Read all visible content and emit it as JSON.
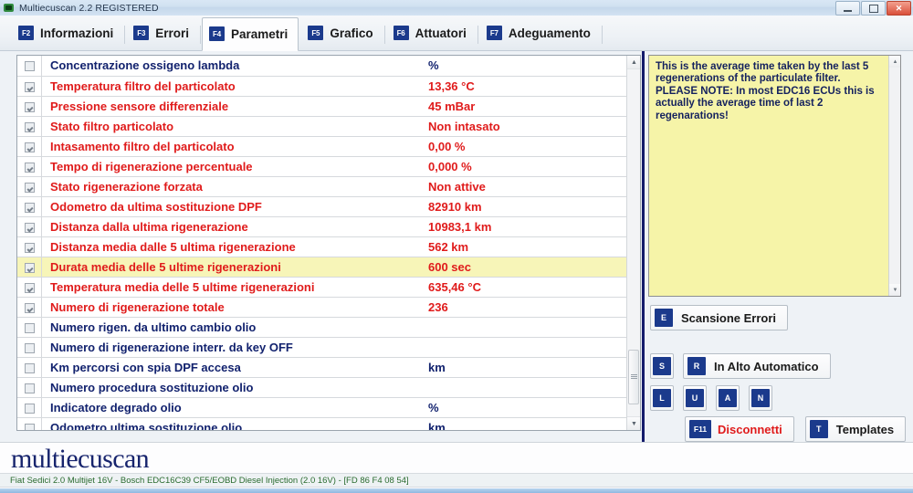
{
  "window": {
    "title": "Multiecuscan 2.2 REGISTERED",
    "icon": "app-icon",
    "minimize": "minimize-icon",
    "maximize": "maximize-icon",
    "close": "✕"
  },
  "tabs": [
    {
      "key": "F2",
      "label": "Informazioni",
      "active": false
    },
    {
      "key": "F3",
      "label": "Errori",
      "active": false
    },
    {
      "key": "F4",
      "label": "Parametri",
      "active": true
    },
    {
      "key": "F5",
      "label": "Grafico",
      "active": false
    },
    {
      "key": "F6",
      "label": "Attuatori",
      "active": false
    },
    {
      "key": "F7",
      "label": "Adeguamento",
      "active": false
    }
  ],
  "table": {
    "rows": [
      {
        "checked": false,
        "name": "Concentrazione ossigeno lambda",
        "value": "%",
        "color": "navy",
        "highlight": false
      },
      {
        "checked": true,
        "name": "Temperatura filtro del particolato",
        "value": "13,36 °C",
        "color": "red",
        "highlight": false
      },
      {
        "checked": true,
        "name": "Pressione sensore differenziale",
        "value": "45 mBar",
        "color": "red",
        "highlight": false
      },
      {
        "checked": true,
        "name": "Stato filtro particolato",
        "value": "Non intasato",
        "color": "red",
        "highlight": false
      },
      {
        "checked": true,
        "name": "Intasamento filtro del particolato",
        "value": "0,00 %",
        "color": "red",
        "highlight": false
      },
      {
        "checked": true,
        "name": "Tempo di rigenerazione percentuale",
        "value": "0,000 %",
        "color": "red",
        "highlight": false
      },
      {
        "checked": true,
        "name": "Stato rigenerazione forzata",
        "value": "Non attive",
        "color": "red",
        "highlight": false
      },
      {
        "checked": true,
        "name": "Odometro da ultima sostituzione DPF",
        "value": "82910 km",
        "color": "red",
        "highlight": false
      },
      {
        "checked": true,
        "name": "Distanza dalla ultima rigenerazione",
        "value": "10983,1 km",
        "color": "red",
        "highlight": false
      },
      {
        "checked": true,
        "name": "Distanza media dalle 5 ultima rigenerazione",
        "value": "562 km",
        "color": "red",
        "highlight": false
      },
      {
        "checked": true,
        "name": "Durata media delle 5 ultime rigenerazioni",
        "value": "600 sec",
        "color": "red",
        "highlight": true
      },
      {
        "checked": true,
        "name": "Temperatura media delle 5 ultime rigenerazioni",
        "value": "635,46 °C",
        "color": "red",
        "highlight": false
      },
      {
        "checked": true,
        "name": "Numero di rigenerazione totale",
        "value": "236",
        "color": "red",
        "highlight": false
      },
      {
        "checked": false,
        "name": "Numero rigen. da ultimo cambio olio",
        "value": "",
        "color": "navy",
        "highlight": false
      },
      {
        "checked": false,
        "name": "Numero di rigenerazione interr. da key OFF",
        "value": "",
        "color": "navy",
        "highlight": false
      },
      {
        "checked": false,
        "name": "Km percorsi con spia DPF accesa",
        "value": "km",
        "color": "navy",
        "highlight": false
      },
      {
        "checked": false,
        "name": "Numero procedura sostituzione olio",
        "value": "",
        "color": "navy",
        "highlight": false
      },
      {
        "checked": false,
        "name": "Indicatore degrado olio",
        "value": "%",
        "color": "navy",
        "highlight": false
      },
      {
        "checked": false,
        "name": "Odometro ultima sostituzione olio",
        "value": "km",
        "color": "navy",
        "highlight": false
      }
    ],
    "scroll_up_icon": "▲",
    "scroll_down_icon": "▼"
  },
  "note": {
    "text": "This is the average time taken by the last 5 regenerations of the particulate filter. PLEASE NOTE: In most EDC16 ECUs this is actually the average time of last 2 regenarations!",
    "lines": [
      "This is the average time taken by the last 5",
      "regenerations of the particulate filter.",
      "PLEASE NOTE: In most EDC16 ECUs this is",
      "actually the average time of last 2",
      "regenarations!"
    ],
    "background": "#f6f4a8",
    "scroll_up_icon": "▲",
    "scroll_down_icon": "▼"
  },
  "buttons": {
    "scan_errors": {
      "key": "E",
      "label": "Scansione Errori"
    },
    "stop": {
      "key": "S",
      "label": ""
    },
    "auto_top": {
      "key": "R",
      "label": "In Alto Automatico"
    },
    "l": {
      "key": "L",
      "label": ""
    },
    "u": {
      "key": "U",
      "label": ""
    },
    "a": {
      "key": "A",
      "label": ""
    },
    "n": {
      "key": "N",
      "label": ""
    },
    "disconnect": {
      "key": "F11",
      "label": "Disconnetti"
    },
    "templates": {
      "key": "T",
      "label": "Templates"
    }
  },
  "footer": {
    "logo": "multiecuscan",
    "status": "Fiat Sedici 2.0 Multijet 16V - Bosch EDC16C39 CF5/EOBD Diesel Injection (2.0 16V) - [FD 86 F4 08 54]"
  },
  "colors": {
    "accent_navy": "#1b3a8c",
    "value_red": "#e01b1b",
    "label_navy": "#12226e",
    "highlight_yellow": "#f7f5b8",
    "note_yellow": "#f6f4a8"
  }
}
